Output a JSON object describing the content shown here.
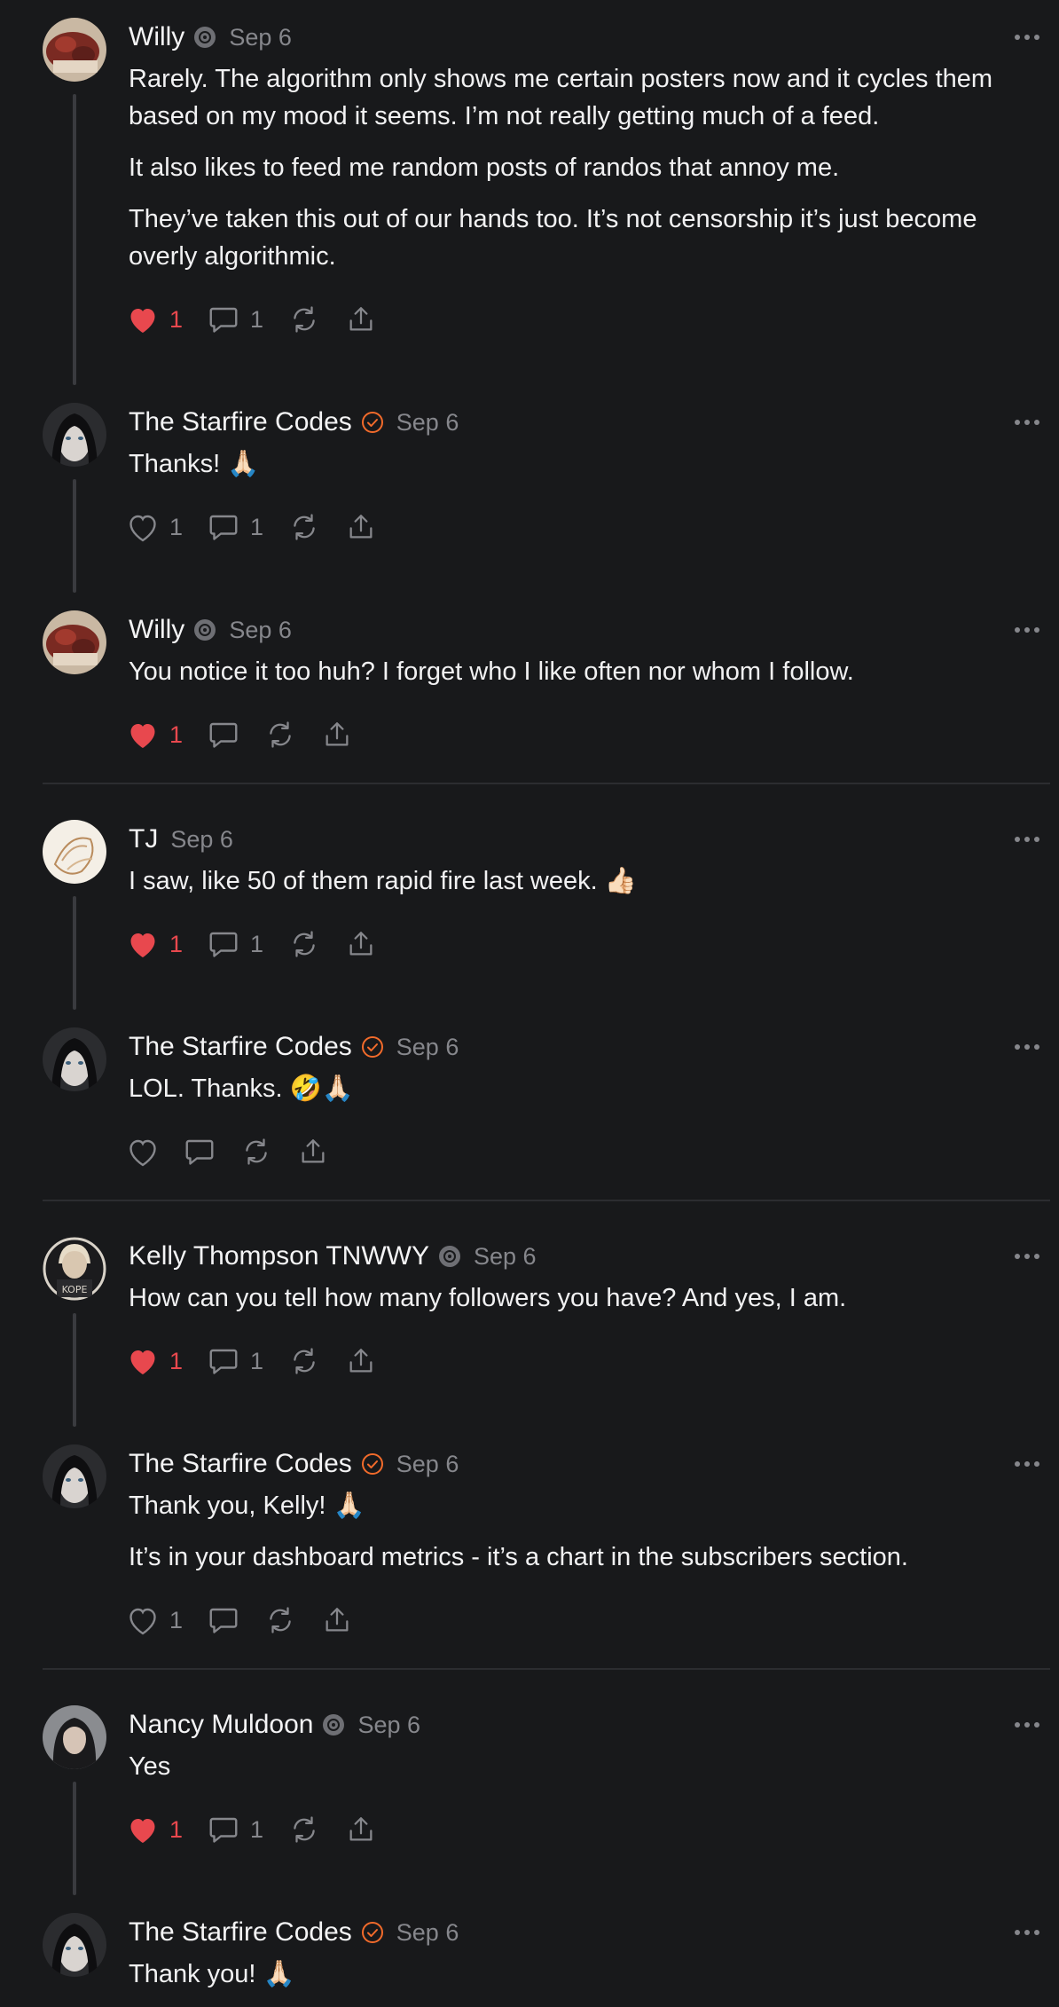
{
  "posts": [
    {
      "author": "Willy",
      "date": "Sep 6",
      "paragraphs": [
        "Rarely. The algorithm only shows me certain posters now and it cycles them based on my mood it seems. I’m not really getting much of a feed.",
        "It also likes to feed me random posts of randos that annoy me.",
        "They’ve taken this out of our hands too. It’s not censorship it’s just become overly algorithmic."
      ],
      "likes": "1",
      "comments": "1"
    },
    {
      "author": "The Starfire Codes",
      "date": "Sep 6",
      "paragraphs": [
        "Thanks! 🙏🏻"
      ],
      "likes": "1",
      "comments": "1"
    },
    {
      "author": "Willy",
      "date": "Sep 6",
      "paragraphs": [
        "You notice it too huh? I forget who I like often nor whom I follow."
      ],
      "likes": "1",
      "comments": ""
    },
    {
      "author": "TJ",
      "date": "Sep 6",
      "paragraphs": [
        "I saw, like 50 of them rapid fire last week. 👍🏻"
      ],
      "likes": "1",
      "comments": "1"
    },
    {
      "author": "The Starfire Codes",
      "date": "Sep 6",
      "paragraphs": [
        "LOL. Thanks. 🤣🙏🏻"
      ],
      "likes": "",
      "comments": ""
    },
    {
      "author": "Kelly Thompson TNWWY",
      "date": "Sep 6",
      "paragraphs": [
        "How can you tell how many followers you have? And yes, I am."
      ],
      "likes": "1",
      "comments": "1"
    },
    {
      "author": "The Starfire Codes",
      "date": "Sep 6",
      "paragraphs": [
        "Thank you, Kelly! 🙏🏻",
        "It’s in your dashboard metrics - it’s a chart in the subscribers section."
      ],
      "likes": "1",
      "comments": ""
    },
    {
      "author": "Nancy Muldoon",
      "date": "Sep 6",
      "paragraphs": [
        "Yes"
      ],
      "likes": "1",
      "comments": "1"
    },
    {
      "author": "The Starfire Codes",
      "date": "Sep 6",
      "paragraphs": [
        "Thank you! 🙏🏻"
      ],
      "likes": "",
      "comments": ""
    }
  ],
  "colors": {
    "background": "#18191b",
    "liked_red": "#e8484e",
    "verified_orange": "#f26b2b",
    "muted_gray": "#86878c"
  },
  "icons": [
    "heart-icon",
    "comment-icon",
    "repost-icon",
    "share-icon",
    "more-options-icon",
    "verified-badge-icon",
    "community-badge-icon"
  ]
}
